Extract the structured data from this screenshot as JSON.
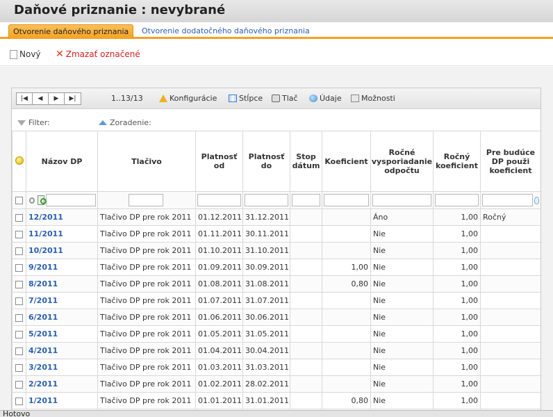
{
  "header": {
    "title": "Daňové priznanie :  nevybrané"
  },
  "tabs": [
    {
      "label": "Otvorenie daňového priznania",
      "active": true
    },
    {
      "label": "Otvorenie dodatočného daňového priznania",
      "active": false
    }
  ],
  "actions": {
    "new_label": "Nový",
    "delete_label": "Zmazať označené"
  },
  "toolbar": {
    "pager_first": "|◀",
    "pager_prev": "◀",
    "pager_next": "▶",
    "pager_last": "▶|",
    "range": "1..13/13",
    "config_label": "Konfigurácie",
    "columns_label": "Stĺpce",
    "print_label": "Tlač",
    "data_label": "Údaje",
    "options_label": "Možnosti"
  },
  "filterbar": {
    "filter_label": "Filter:",
    "sort_label": "Zoradenie:"
  },
  "columns": [
    {
      "key": "nazov",
      "label": "Názov DP"
    },
    {
      "key": "tlacivo",
      "label": "Tlačivo"
    },
    {
      "key": "od",
      "label": "Platnosť od"
    },
    {
      "key": "do",
      "label": "Platnosť do"
    },
    {
      "key": "stop",
      "label": "Stop dátum"
    },
    {
      "key": "koef",
      "label": "Koeficient"
    },
    {
      "key": "rocne",
      "label": "Ročné vysporiadanie odpočtu"
    },
    {
      "key": "rocny",
      "label": "Ročný koeficient"
    },
    {
      "key": "buduce",
      "label": "Pre budúce DP použi koeficient"
    }
  ],
  "rows": [
    {
      "nazov": "12/2011",
      "tlacivo": "Tlačivo DP pre rok 2011",
      "od": "01.12.2011",
      "do": "31.12.2011",
      "stop": "",
      "koef": "",
      "rocne": "Áno",
      "rocny": "1,00",
      "buduce": "Ročný"
    },
    {
      "nazov": "11/2011",
      "tlacivo": "Tlačivo DP pre rok 2011",
      "od": "01.11.2011",
      "do": "30.11.2011",
      "stop": "",
      "koef": "",
      "rocne": "Nie",
      "rocny": "1,00",
      "buduce": ""
    },
    {
      "nazov": "10/2011",
      "tlacivo": "Tlačivo DP pre rok 2011",
      "od": "01.10.2011",
      "do": "31.10.2011",
      "stop": "",
      "koef": "",
      "rocne": "Nie",
      "rocny": "1,00",
      "buduce": ""
    },
    {
      "nazov": "9/2011",
      "tlacivo": "Tlačivo DP pre rok 2011",
      "od": "01.09.2011",
      "do": "30.09.2011",
      "stop": "",
      "koef": "1,00",
      "rocne": "Nie",
      "rocny": "1,00",
      "buduce": ""
    },
    {
      "nazov": "8/2011",
      "tlacivo": "Tlačivo DP pre rok 2011",
      "od": "01.08.2011",
      "do": "31.08.2011",
      "stop": "",
      "koef": "0,80",
      "rocne": "Nie",
      "rocny": "1,00",
      "buduce": ""
    },
    {
      "nazov": "7/2011",
      "tlacivo": "Tlačivo DP pre rok 2011",
      "od": "01.07.2011",
      "do": "31.07.2011",
      "stop": "",
      "koef": "",
      "rocne": "Nie",
      "rocny": "1,00",
      "buduce": ""
    },
    {
      "nazov": "6/2011",
      "tlacivo": "Tlačivo DP pre rok 2011",
      "od": "01.06.2011",
      "do": "30.06.2011",
      "stop": "",
      "koef": "",
      "rocne": "Nie",
      "rocny": "1,00",
      "buduce": ""
    },
    {
      "nazov": "5/2011",
      "tlacivo": "Tlačivo DP pre rok 2011",
      "od": "01.05.2011",
      "do": "31.05.2011",
      "stop": "",
      "koef": "",
      "rocne": "Nie",
      "rocny": "1,00",
      "buduce": ""
    },
    {
      "nazov": "4/2011",
      "tlacivo": "Tlačivo DP pre rok 2011",
      "od": "01.04.2011",
      "do": "30.04.2011",
      "stop": "",
      "koef": "",
      "rocne": "Nie",
      "rocny": "1,00",
      "buduce": ""
    },
    {
      "nazov": "3/2011",
      "tlacivo": "Tlačivo DP pre rok 2011",
      "od": "01.03.2011",
      "do": "31.03.2011",
      "stop": "",
      "koef": "",
      "rocne": "Nie",
      "rocny": "1,00",
      "buduce": ""
    },
    {
      "nazov": "2/2011",
      "tlacivo": "Tlačivo DP pre rok 2011",
      "od": "01.02.2011",
      "do": "28.02.2011",
      "stop": "",
      "koef": "",
      "rocne": "Nie",
      "rocny": "1,00",
      "buduce": ""
    },
    {
      "nazov": "1/2011",
      "tlacivo": "Tlačivo DP pre rok 2011",
      "od": "01.01.2011",
      "do": "31.01.2011",
      "stop": "",
      "koef": "0,80",
      "rocne": "Nie",
      "rocny": "1,00",
      "buduce": ""
    }
  ],
  "status": {
    "text": "Hotovo"
  }
}
